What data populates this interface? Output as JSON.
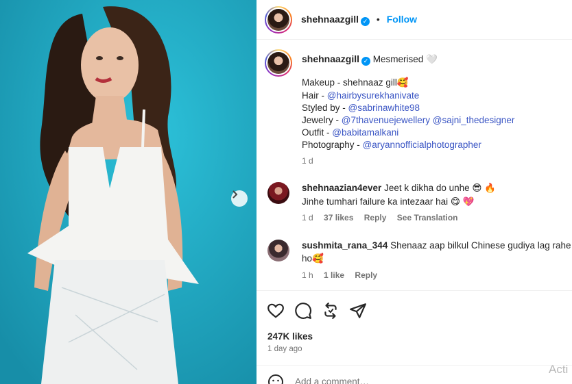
{
  "post": {
    "username": "shehnaazgill",
    "follow_label": "Follow",
    "dot": "•",
    "verified_glyph": "✓"
  },
  "caption": {
    "username": "shehnaazgill",
    "first_line": "Mesmerised 🤍",
    "lines": [
      {
        "prefix": "Makeup - shehnaaz gill🥰",
        "mention": ""
      },
      {
        "prefix": "Hair - ",
        "mention": "@hairbysurekhanivate"
      },
      {
        "prefix": "Styled by - ",
        "mention": "@sabrinawhite98"
      },
      {
        "prefix": "Jewelry - ",
        "mention": "@7thavenuejewellery @sajni_thedesigner"
      },
      {
        "prefix": "Outfit - ",
        "mention": "@babitamalkani"
      },
      {
        "prefix": "Photography - ",
        "mention": "@aryannofficialphotographer"
      }
    ],
    "time": "1 d"
  },
  "comments": [
    {
      "username": "shehnaazian4ever",
      "line1": "Jeet k dikha do unhe 😎 🔥",
      "line2": "Jinhe tumhari failure ka intezaar hai 😋 💖",
      "time": "1 d",
      "likes": "37 likes",
      "reply": "Reply",
      "translation": "See Translation"
    },
    {
      "username": "sushmita_rana_344",
      "line1": "Shenaaz aap bilkul Chinese gudiya lag rahe",
      "line2": "ho🥰",
      "time": "1 h",
      "likes": "1 like",
      "reply": "Reply"
    }
  ],
  "actions": {
    "icons": [
      "heart-icon",
      "comment-icon",
      "repost-icon",
      "share-icon"
    ]
  },
  "likes_count": "247K likes",
  "posted_ago": "1 day ago",
  "add_comment_placeholder": "Add a comment…",
  "watermark": "Acti",
  "colors": {
    "photo_background": "#1fa5c0",
    "link": "#3a55c4",
    "follow": "#0095f6",
    "muted": "#737373"
  }
}
